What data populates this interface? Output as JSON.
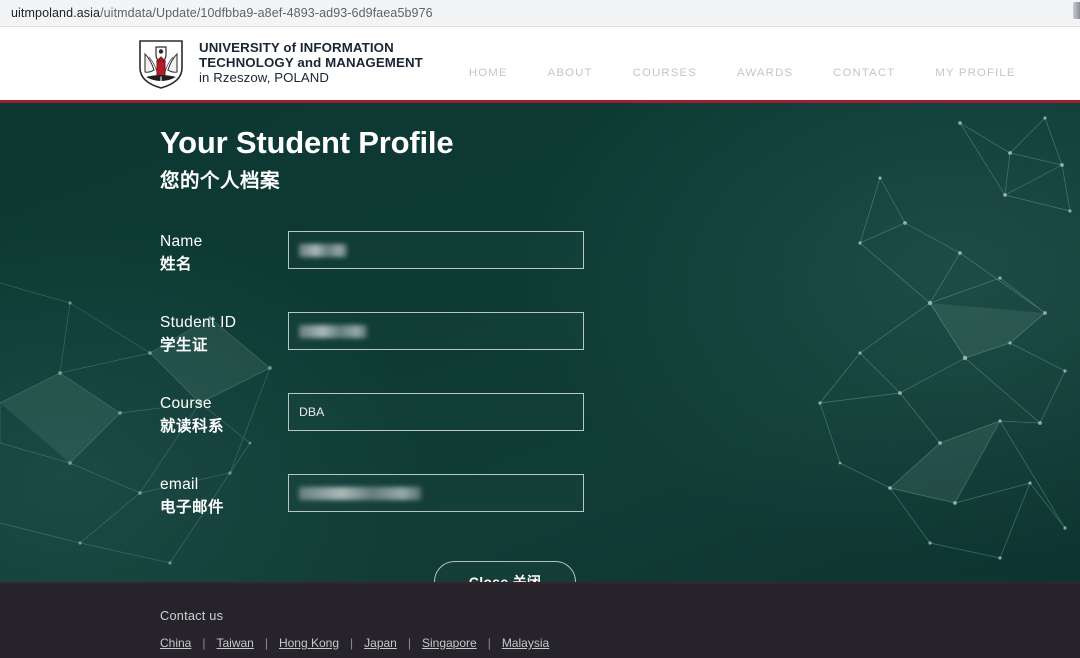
{
  "browser": {
    "url_host": "uitmpoland.asia",
    "url_path": "/uitmdata/Update/10dfbba9-a8ef-4893-ad93-6d9faea5b976"
  },
  "header": {
    "brand_line1": "UNIVERSITY of INFORMATION",
    "brand_line2": "TECHNOLOGY and MANAGEMENT",
    "brand_line3": "in Rzeszow, POLAND",
    "crest_icon": "university-crest-icon",
    "nav": [
      {
        "label": "HOME"
      },
      {
        "label": "ABOUT"
      },
      {
        "label": "COURSES"
      },
      {
        "label": "AWARDS"
      },
      {
        "label": "CONTACT"
      },
      {
        "label": "MY PROFILE"
      }
    ]
  },
  "hero": {
    "title_en": "Your Student Profile",
    "title_zh": "您的个人档案",
    "fields": [
      {
        "label_en": "Name",
        "label_zh": "姓名",
        "value": "",
        "redacted": true,
        "redaction_width": "w1"
      },
      {
        "label_en": "Student ID",
        "label_zh": "学生证",
        "value": "",
        "redacted": true,
        "redaction_width": "w2"
      },
      {
        "label_en": "Course",
        "label_zh": "就读科系",
        "value": "DBA",
        "redacted": false,
        "redaction_width": ""
      },
      {
        "label_en": "email",
        "label_zh": "电子邮件",
        "value": "",
        "redacted": true,
        "redaction_width": "w3"
      }
    ],
    "close_button": "Close 关闭"
  },
  "footer": {
    "contact_heading": "Contact us",
    "links": [
      {
        "label": "China"
      },
      {
        "label": "Taiwan"
      },
      {
        "label": "Hong Kong"
      },
      {
        "label": "Japan"
      },
      {
        "label": "Singapore"
      },
      {
        "label": "Malaysia "
      }
    ],
    "separator": "|"
  },
  "colors": {
    "hero_bg": "#0e3a34",
    "accent_red": "#9e1f35",
    "footer_bg": "#26242a",
    "field_border": "#b9c7c4"
  }
}
